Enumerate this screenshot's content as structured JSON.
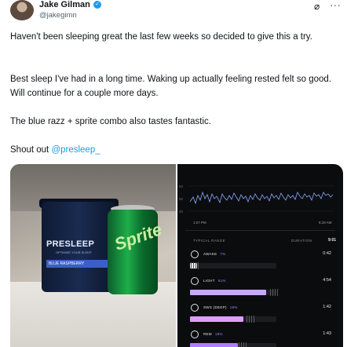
{
  "author": {
    "name": "Jake Gilman",
    "handle": "@jakegimn",
    "verified_icon": "verified-badge-icon"
  },
  "header_icons": [
    "grok-icon",
    "more-icon"
  ],
  "tweet": {
    "para1": "Haven't been sleeping great the last few weeks so decided to give this a try.",
    "para2": "Best sleep I've had in a long time. Waking up actually feeling rested felt so good. Will continue for a couple more days.",
    "para3": "The blue razz + sprite combo also tastes fantastic.",
    "shout_prefix": "Shout out ",
    "mention": "@presleep_"
  },
  "photo": {
    "tub_brand": "PRESLEEP",
    "tub_sub": "OPTIMIZE YOUR SLEEP",
    "tub_flavor": "BLUE RASPBERRY",
    "can_logo": "Sprite"
  },
  "sleep_app": {
    "y_ticks": [
      "60",
      "50",
      "40"
    ],
    "start_time": "1:07 PM",
    "end_time": "6:19 AM",
    "range_header": "TYPICAL RANGE",
    "duration_header": "DURATION",
    "total_duration": "9:01",
    "stages": [
      {
        "name": "AWAKE",
        "pct": "7%",
        "duration": "0:42",
        "fill_fraction": 0.08,
        "color": "#e9e9e9"
      },
      {
        "name": "LIGHT",
        "pct": "51%",
        "duration": "4:54",
        "fill_fraction": 0.88,
        "color": "#c6a8ff"
      },
      {
        "name": "SWS (DEEP)",
        "pct": "19%",
        "duration": "1:42",
        "fill_fraction": 0.62,
        "color": "#e19cff"
      },
      {
        "name": "REM",
        "pct": "19%",
        "duration": "1:43",
        "fill_fraction": 0.55,
        "color": "#b07dff"
      }
    ],
    "colors": {
      "accent": "#9b8cff",
      "background": "#0b0c0e"
    }
  }
}
